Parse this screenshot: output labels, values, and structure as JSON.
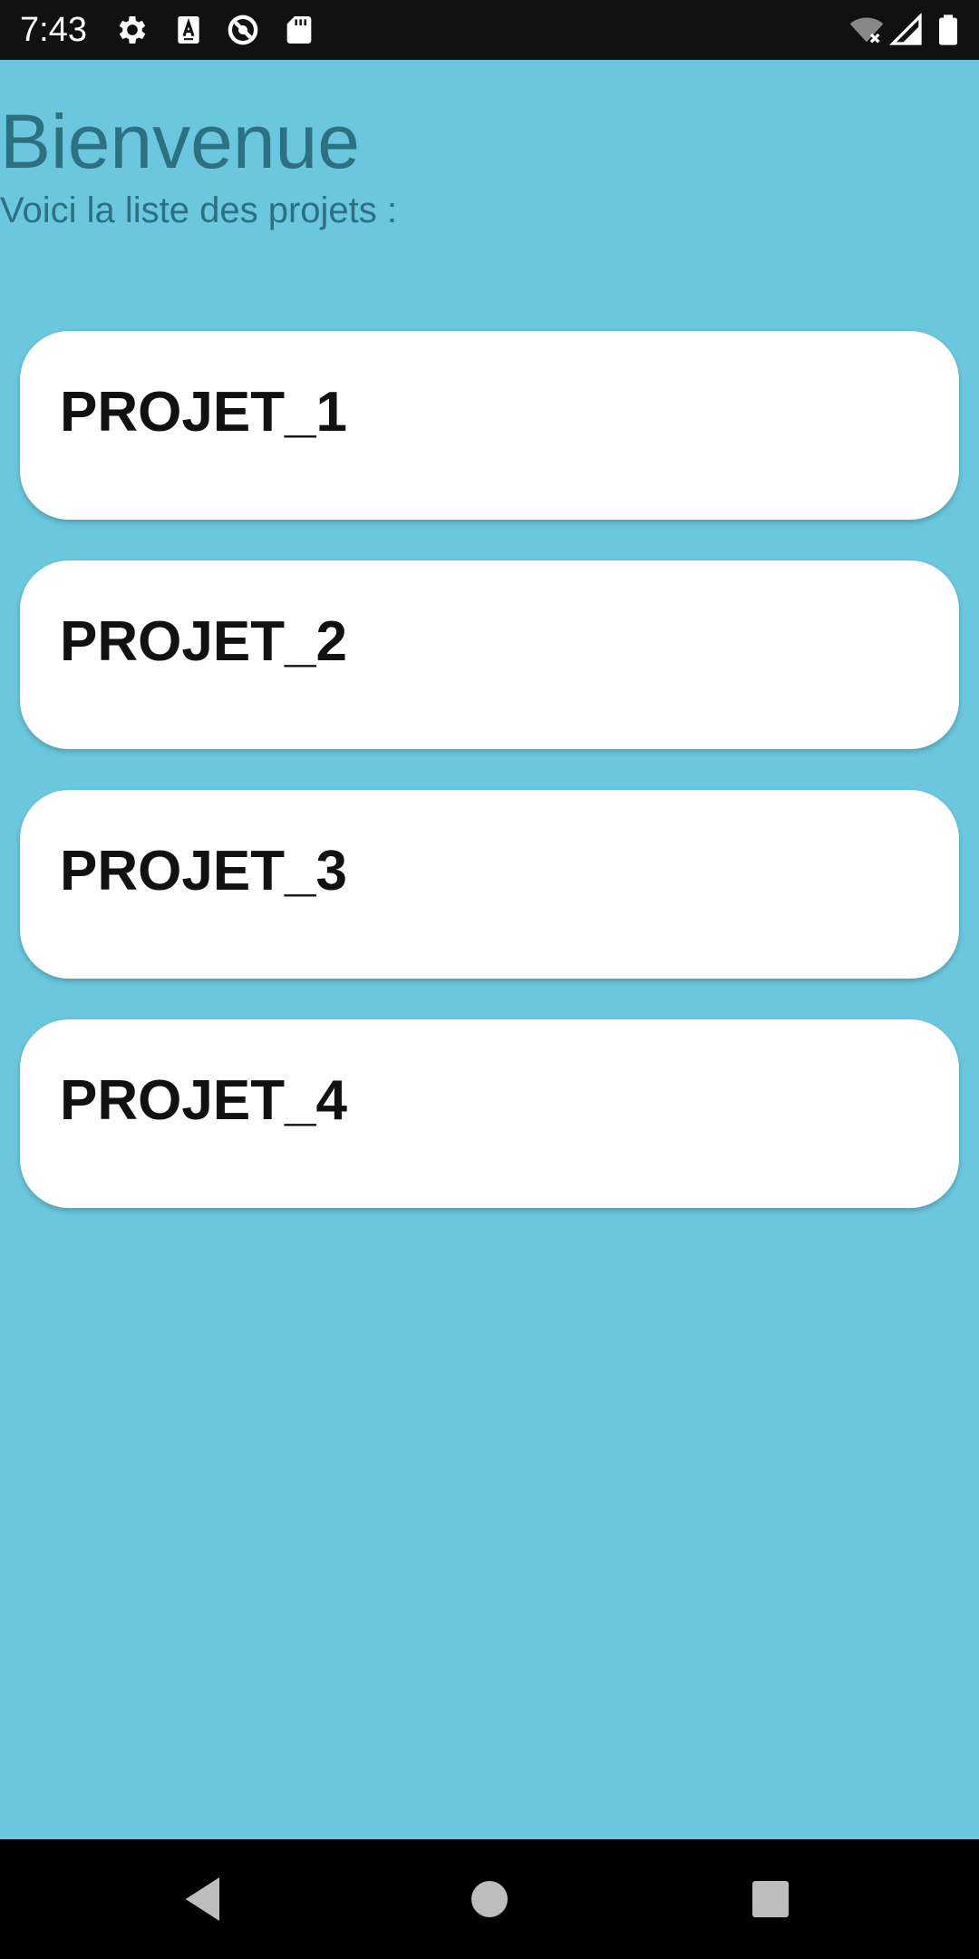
{
  "status_bar": {
    "time": "7:43",
    "icons_left": [
      "settings-icon",
      "keyboard-a-icon",
      "data-saver-icon",
      "sd-card-icon"
    ],
    "icons_right": [
      "wifi-off-icon",
      "cell-signal-icon",
      "battery-icon"
    ]
  },
  "header": {
    "title": "Bienvenue",
    "subtitle": "Voici la liste des projets :"
  },
  "projects": [
    {
      "name": "PROJET_1"
    },
    {
      "name": "PROJET_2"
    },
    {
      "name": "PROJET_3"
    },
    {
      "name": "PROJET_4"
    }
  ],
  "nav_bar": {
    "buttons": [
      "back-icon",
      "home-icon",
      "recents-icon"
    ]
  },
  "colors": {
    "background": "#6ac7de",
    "title_text": "#2e6f80",
    "card": "#ffffff",
    "card_text": "#111111",
    "status_bar": "#111111",
    "nav_bar": "#000000"
  }
}
